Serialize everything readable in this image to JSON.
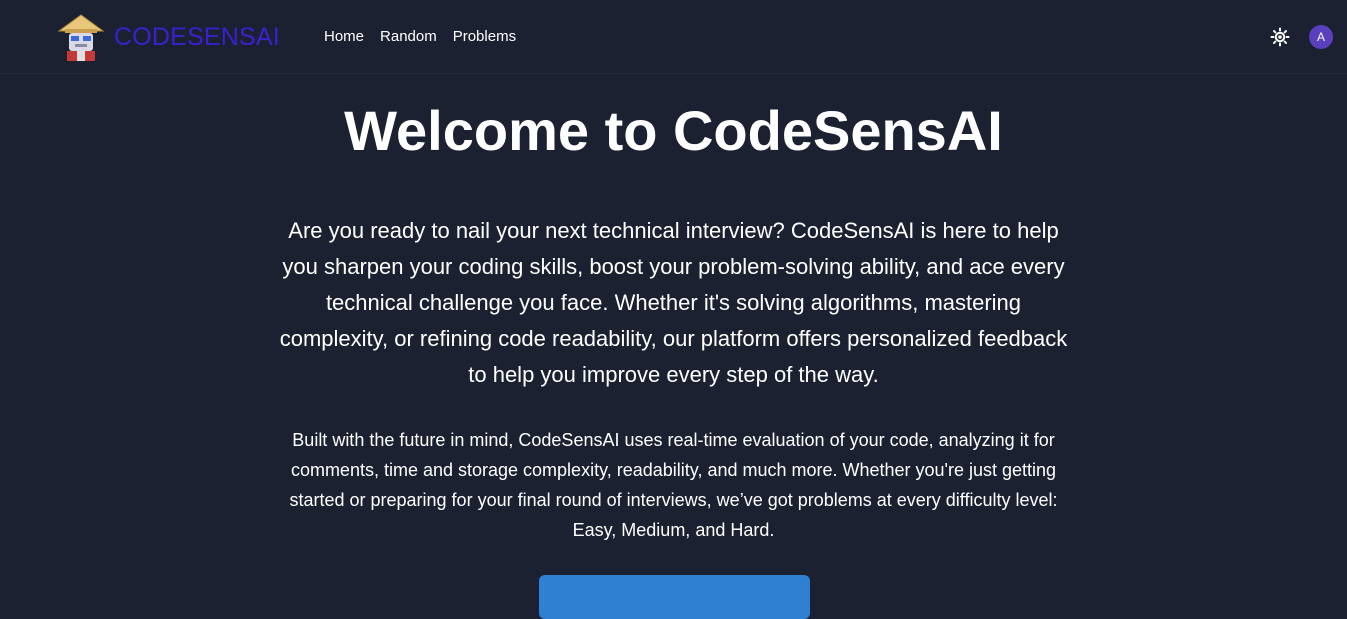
{
  "navbar": {
    "brand": "CODESENSAI",
    "links": [
      "Home",
      "Random",
      "Problems"
    ],
    "theme_icon": "sun-icon",
    "avatar_initial": "A"
  },
  "hero": {
    "title": "Welcome to CodeSensAI",
    "intro": "Are you ready to nail your next technical interview? CodeSensAI is here to help you sharpen your coding skills, boost your problem-solving ability, and ace every technical challenge you face. Whether it's solving algorithms, mastering complexity, or refining code readability, our platform offers personalized feedback to help you improve every step of the way.",
    "details": "Built with the future in mind, CodeSensAI uses real-time evaluation of your code, analyzing it for comments, time and storage complexity, readability, and much more. Whether you're just getting started or preparing for your final round of interviews, we’ve got problems at every difficulty level: Easy, Medium, and Hard."
  },
  "colors": {
    "background": "#1b2130",
    "brand": "#3b1fd1",
    "button": "#2f7fd3",
    "avatar": "#5a3fbf"
  }
}
